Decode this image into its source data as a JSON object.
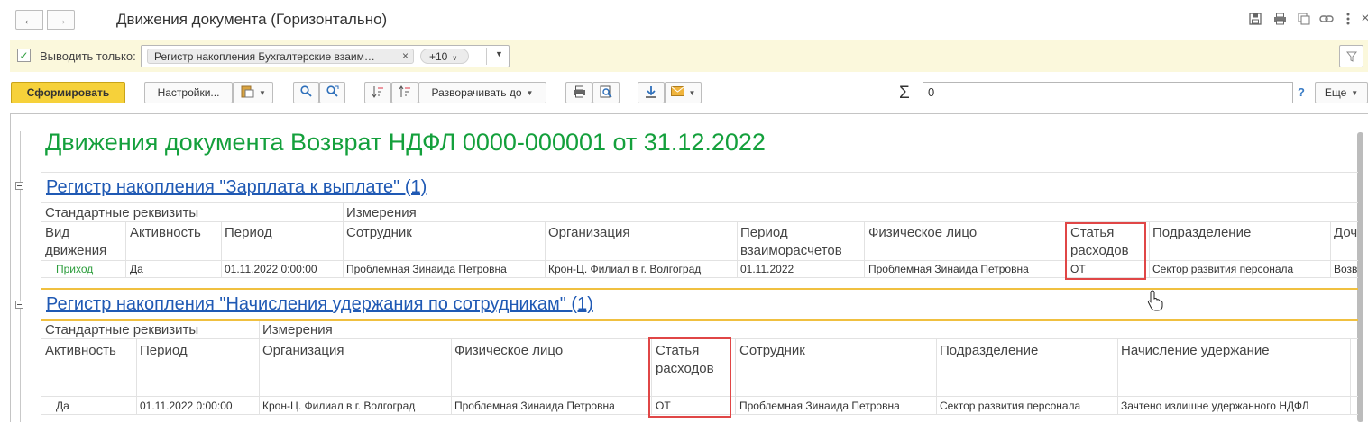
{
  "window": {
    "title": "Движения документа (Горизонтально)",
    "nav_back": "←",
    "nav_forward": "→"
  },
  "filter": {
    "label": "Выводить только:",
    "tag": "Регистр накопления Бухгалтерские взаим…",
    "more": "+10"
  },
  "toolbar": {
    "generate": "Сформировать",
    "settings": "Настройки...",
    "expand": "Разворачивать до",
    "sum_value": "0",
    "help": "?",
    "more": "Еще"
  },
  "report": {
    "title": "Движения документа Возврат НДФЛ 0000-000001 от 31.12.2022",
    "registers": [
      {
        "title": "Регистр накопления \"Зарплата к выплате\" (1)",
        "group_std": "Стандартные реквизиты",
        "group_dims": "Измерения",
        "columns": [
          "Вид движения",
          "Активность",
          "Период",
          "Сотрудник",
          "Организация",
          "Период взаиморасчетов",
          "Физическое лицо",
          "Статья расходов",
          "Подразделение",
          "Доч"
        ],
        "row": [
          "Приход",
          "Да",
          "01.11.2022 0:00:00",
          "Проблемная Зинаида Петровна",
          "Крон-Ц. Филиал в г. Волгоград",
          "01.11.2022",
          "Проблемная Зинаида Петровна",
          "ОТ",
          "Сектор развития персонала",
          "Возв"
        ]
      },
      {
        "title": "Регистр накопления \"Начисления удержания по сотрудникам\" (1)",
        "group_std": "Стандартные реквизиты",
        "group_dims": "Измерения",
        "columns": [
          "Активность",
          "Период",
          "Организация",
          "Физическое лицо",
          "Статья расходов",
          "Сотрудник",
          "Подразделение",
          "Начисление удержание"
        ],
        "row": [
          "Да",
          "01.11.2022 0:00:00",
          "Крон-Ц. Филиал в г. Волгоград",
          "Проблемная Зинаида Петровна",
          "ОТ",
          "Проблемная Зинаида Петровна",
          "Сектор развития персонала",
          "Зачтено излишне удержанного НДФЛ"
        ]
      }
    ]
  },
  "icons": [
    "back-arrow-icon",
    "forward-arrow-icon",
    "save-icon",
    "print-icon",
    "copy-icon",
    "link-icon",
    "more-vertical-icon",
    "close-icon",
    "filter-icon",
    "search-icon",
    "search-next-icon",
    "sort-icon",
    "print-icon",
    "preview-icon",
    "download-icon",
    "email-icon",
    "sigma-icon",
    "collapse-icon"
  ]
}
